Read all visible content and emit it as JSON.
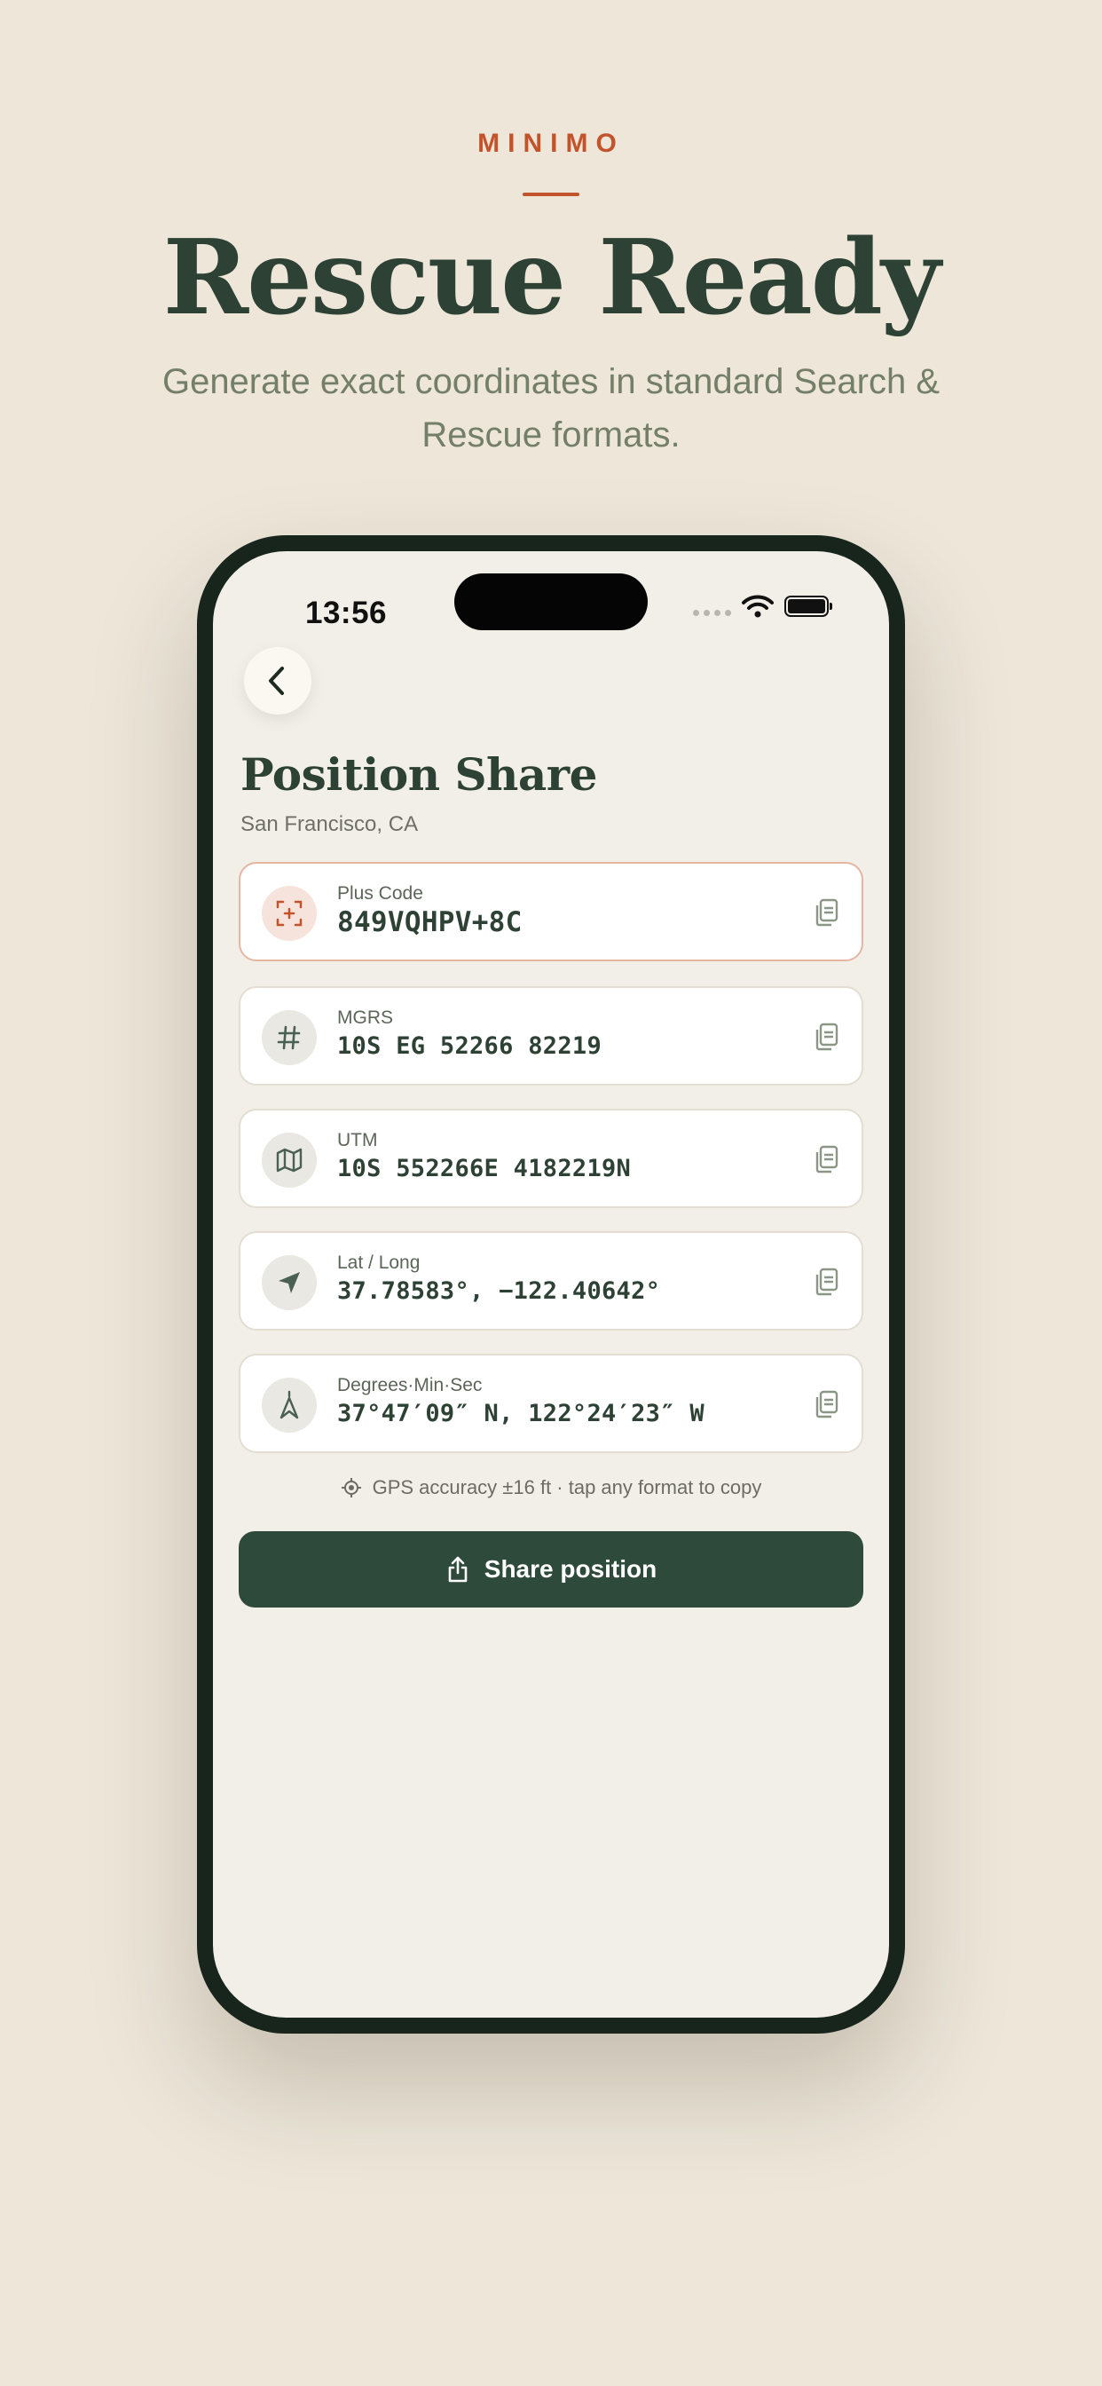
{
  "brand": "MINIMO",
  "headline": "Rescue Ready",
  "subhead": "Generate exact coordinates in standard Search & Rescue formats.",
  "colors": {
    "accent": "#c2532a",
    "primary": "#2e4a3b",
    "background": "#ede6d9"
  },
  "status_bar": {
    "time": "13:56"
  },
  "screen": {
    "title": "Position Share",
    "location": "San Francisco, CA",
    "formats": [
      {
        "label": "Plus Code",
        "value": "849VQHPV+8C",
        "icon": "plus-code-icon",
        "selected": true
      },
      {
        "label": "MGRS",
        "value": "10S EG 52266 82219",
        "icon": "hash-icon",
        "selected": false
      },
      {
        "label": "UTM",
        "value": "10S 552266E 4182219N",
        "icon": "map-icon",
        "selected": false
      },
      {
        "label": "Lat / Long",
        "value": "37.78583°, −122.40642°",
        "icon": "navigation-arrow-icon",
        "selected": false
      },
      {
        "label": "Degrees·Min·Sec",
        "value": "37°47′09″ N, 122°24′23″ W",
        "icon": "compass-icon",
        "selected": false
      }
    ],
    "accuracy_note": "GPS accuracy ±16 ft · tap any format to copy",
    "share_label": "Share position"
  }
}
